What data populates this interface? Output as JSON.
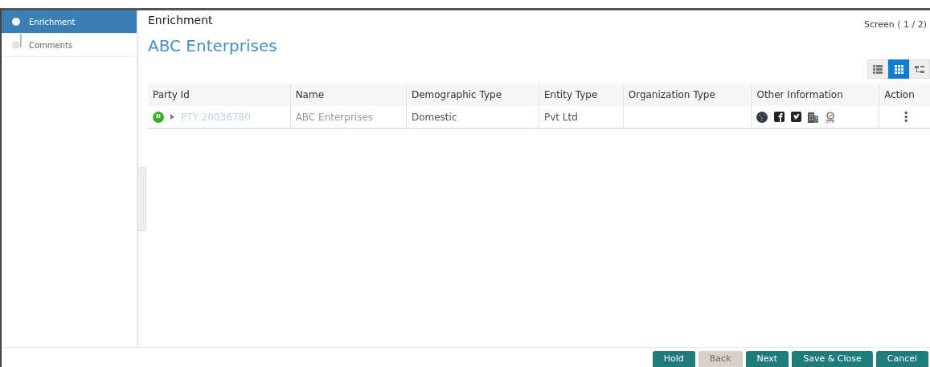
{
  "steps": [
    {
      "label": "Enrichment",
      "selected": true
    },
    {
      "label": "Comments",
      "selected": false
    }
  ],
  "header": {
    "title": "Enrichment",
    "screen": "Screen ( 1 / 2)"
  },
  "party_title": "ABC Enterprises",
  "view_toggle": [
    {
      "kind": "list",
      "selected": false
    },
    {
      "kind": "grid",
      "selected": true
    },
    {
      "kind": "tree",
      "selected": false
    }
  ],
  "table": {
    "columns": [
      "Party Id",
      "Name",
      "Demographic Type",
      "Entity Type",
      "Organization Type",
      "Other Information",
      "Action"
    ],
    "rows": [
      {
        "badge": "N",
        "party_id": "PTY 20036780",
        "name": "ABC Enterprises",
        "demographic_type": "Domestic",
        "entity_type": "Pvt Ltd",
        "organization_type": "",
        "action": "⋮"
      }
    ]
  },
  "buttons": [
    {
      "label": "Hold",
      "disabled": false
    },
    {
      "label": "Back",
      "disabled": true
    },
    {
      "label": "Next",
      "disabled": false
    },
    {
      "label": "Save & Close",
      "disabled": false
    },
    {
      "label": "Cancel",
      "disabled": false
    }
  ]
}
